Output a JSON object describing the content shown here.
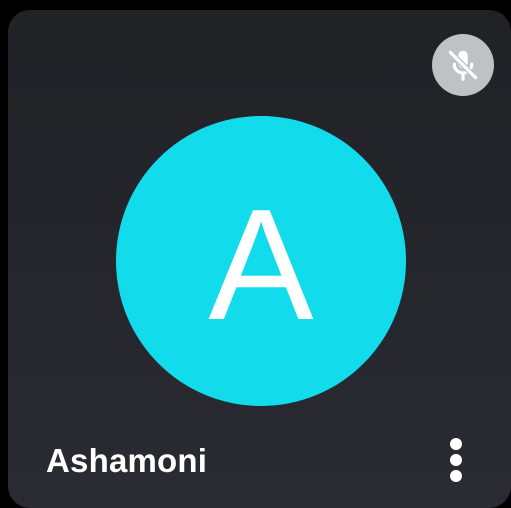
{
  "participant": {
    "name": "Ashamoni",
    "initial": "A",
    "avatar_color": "#12dcec"
  },
  "status": {
    "microphone_muted": true,
    "mute_icon": "mic-off-icon",
    "badge_color": "#bfc1c4"
  },
  "actions": {
    "more_icon": "more-vert-icon"
  },
  "colors": {
    "tile_background": "#25262c",
    "text": "#ffffff"
  }
}
